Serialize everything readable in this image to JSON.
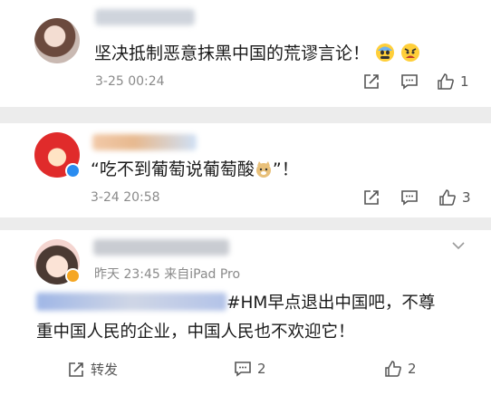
{
  "comments": [
    {
      "text": "坚决抵制恶意抹黑中国的荒谬言论！",
      "time": "3-25 00:24",
      "likes": "1",
      "emojis": [
        "fearful-face-emoji",
        "angry-face-emoji"
      ]
    },
    {
      "text": "“吃不到葡萄说葡萄酸",
      "text_tail": "”！",
      "time": "3-24 20:58",
      "likes": "3",
      "emojis": [
        "doge-emoji"
      ]
    },
    {
      "meta": "昨天 23:45  来自iPad Pro",
      "text_line1": "#HM早点退出中国吧，不尊",
      "text_line2": "重中国人民的企业，中国人民也不欢迎它！",
      "repost_label": "转发",
      "comments": "2",
      "likes": "2"
    }
  ],
  "colors": {
    "verified_blue": "#2a8cf0",
    "verified_orange": "#f5a623",
    "icon": "#555555"
  }
}
